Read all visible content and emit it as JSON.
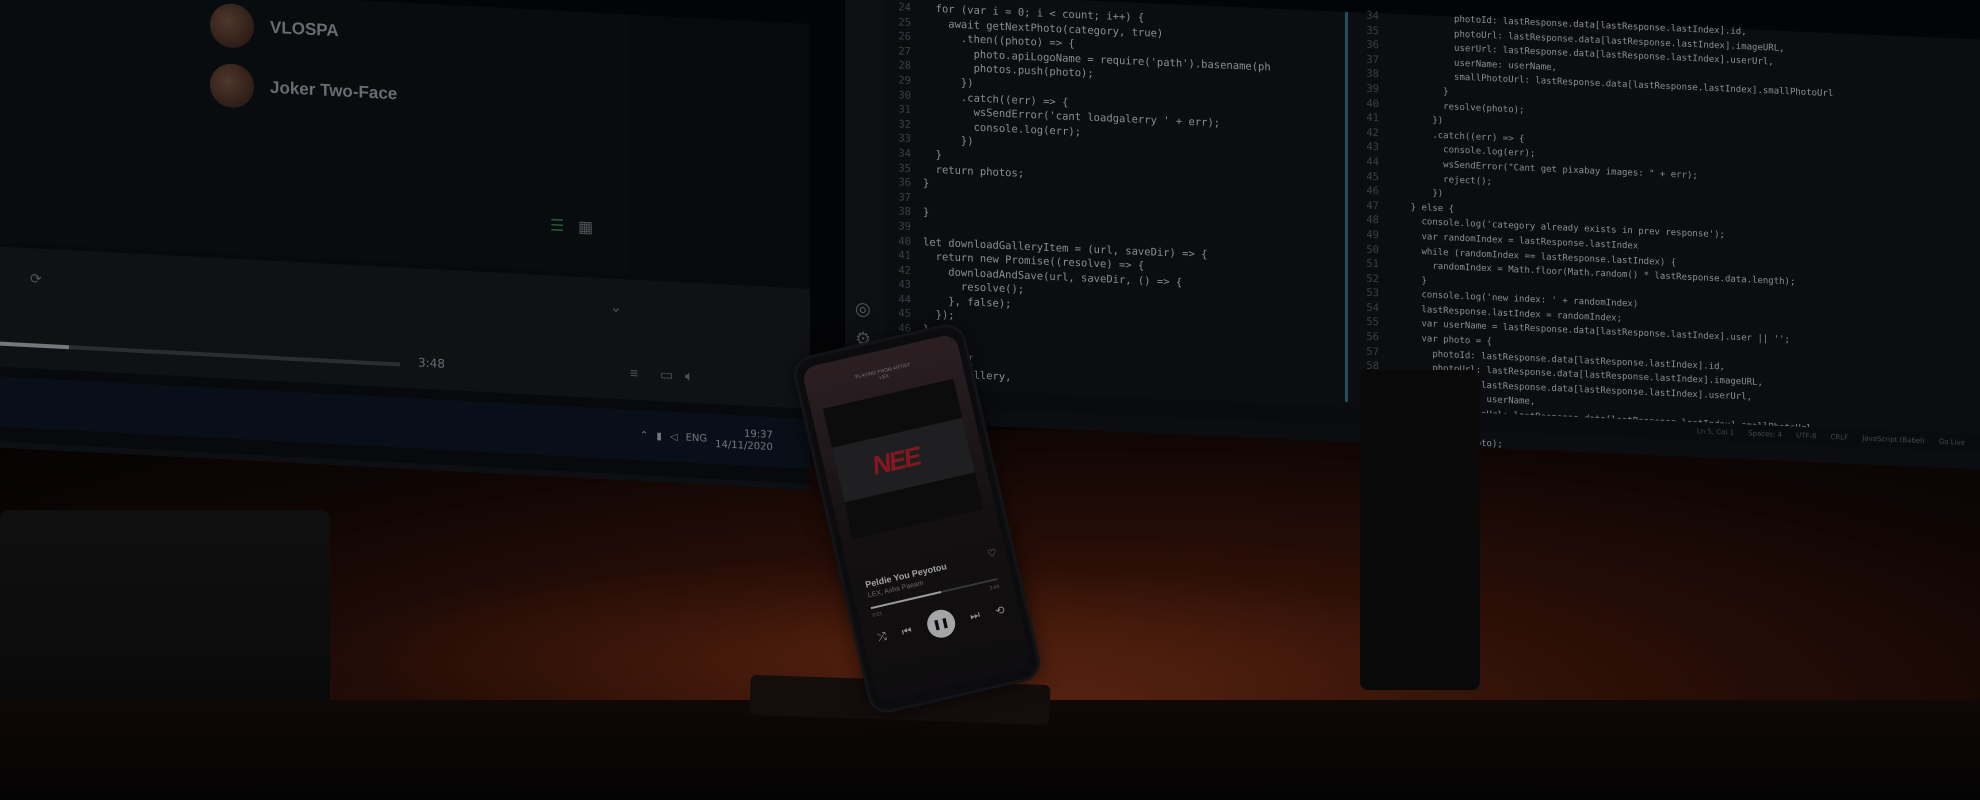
{
  "left_monitor": {
    "playlist": [
      {
        "name": "VLOSPA"
      },
      {
        "name": "Joker Two-Face"
      }
    ],
    "player": {
      "elapsed": "",
      "duration": "3:48",
      "progress": 0.23
    },
    "taskbar": {
      "language": "ENG",
      "time": "19:37",
      "date": "14/11/2020"
    }
  },
  "right_monitor": {
    "code_left_start_line": 24,
    "code_left": [
      "  for (var i = 0; i < count; i++) {",
      "    await getNextPhoto(category, true)",
      "      .then((photo) => {",
      "        photo.apiLogoName = require('path').basename(ph",
      "        photos.push(photo);",
      "      })",
      "      .catch((err) => {",
      "        wsSendError('cant loadgalerry ' + err);",
      "        console.log(err);",
      "      })",
      "  }",
      "  return photos;",
      "}",
      "",
      "}",
      "",
      "let downloadGalleryItem = (url, saveDir) => {",
      "  return new Promise((resolve) => {",
      "    downloadAndSave(url, saveDir, () => {",
      "      resolve();",
      "    }, false);",
      "  });",
      "}",
      "",
      "export {",
      "  loadGallery,"
    ],
    "code_right_start_line": 34,
    "code_right": [
      "            photoId: lastResponse.data[lastResponse.lastIndex].id,",
      "            photoUrl: lastResponse.data[lastResponse.lastIndex].imageURL,",
      "            userUrl: lastResponse.data[lastResponse.lastIndex].userUrl,",
      "            userName: userName,",
      "            smallPhotoUrl: lastResponse.data[lastResponse.lastIndex].smallPhotoUrl",
      "          }",
      "          resolve(photo);",
      "        })",
      "        .catch((err) => {",
      "          console.log(err);",
      "          wsSendError(\"Cant get pixabay images: \" + err);",
      "          reject();",
      "        })",
      "    } else {",
      "      console.log('category already exists in prev response');",
      "      var randomIndex = lastResponse.lastIndex",
      "      while (randomIndex == lastResponse.lastIndex) {",
      "        randomIndex = Math.floor(Math.random() * lastResponse.data.length);",
      "      }",
      "      console.log('new index: ' + randomIndex)",
      "      lastResponse.lastIndex = randomIndex;",
      "      var userName = lastResponse.data[lastResponse.lastIndex].user || '';",
      "      var photo = {",
      "        photoId: lastResponse.data[lastResponse.lastIndex].id,",
      "        photoUrl: lastResponse.data[lastResponse.lastIndex].imageURL,",
      "        userUrl: lastResponse.data[lastResponse.lastIndex].userUrl,",
      "        userName: userName,",
      "        smallPhotoUrl: lastResponse.data[lastResponse.lastIndex].smallPhotoUrl",
      "      }",
      "      resolve(photo);"
    ],
    "status_bar": [
      "Ln 5, Col 1",
      "Spaces: 4",
      "UTF-8",
      "CRLF",
      "JavaScript (Babel)",
      "Go Live"
    ]
  },
  "phone": {
    "header_line1": "PLAYING FROM ARTIST",
    "header_line2": "LEX",
    "album_logo": "NEE",
    "song_title": "Peldie You Peyotou",
    "artist": "LEX, Asha Paeam",
    "elapsed": "0:01",
    "duration": "3:49",
    "progress": 0.55
  },
  "colors": {
    "wall_glow": "#6a2a14",
    "accent_divider": "#2a6a7a",
    "album_logo": "#b0202a"
  }
}
